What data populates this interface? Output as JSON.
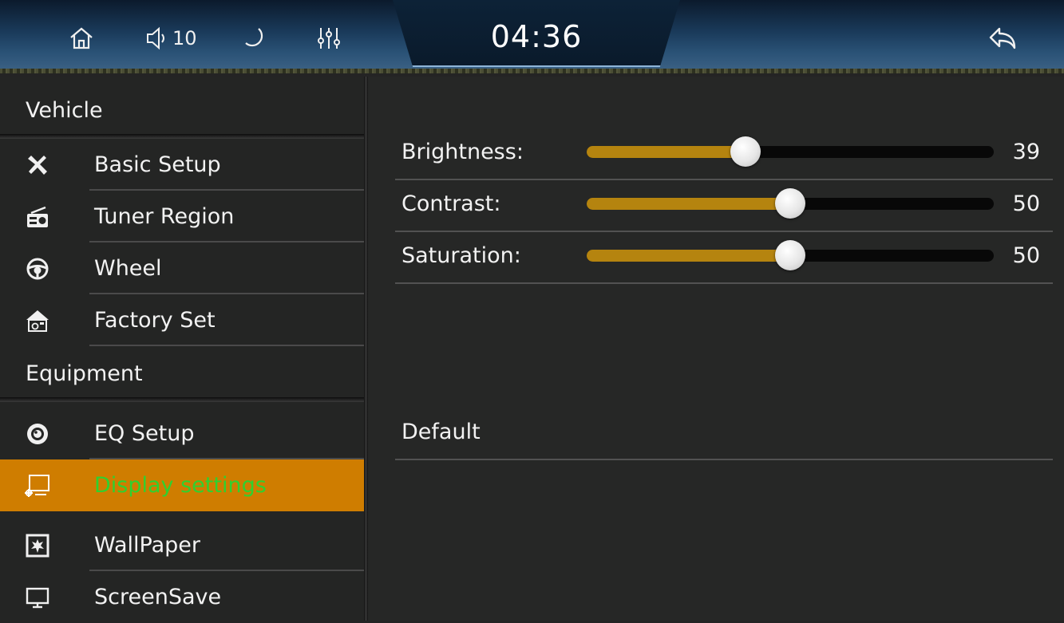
{
  "status_bar": {
    "volume_level": "10",
    "clock": "04:36",
    "icons": [
      "home-icon",
      "volume-icon",
      "night-mode-icon",
      "equalizer-icon",
      "back-icon"
    ]
  },
  "sidebar": {
    "section_vehicle": "Vehicle",
    "section_equipment": "Equipment",
    "items": [
      {
        "label": "Basic Setup",
        "icon": "tools-icon"
      },
      {
        "label": "Tuner Region",
        "icon": "radio-icon"
      },
      {
        "label": "Wheel",
        "icon": "steering-wheel-icon"
      },
      {
        "label": "Factory Set",
        "icon": "factory-house-icon"
      },
      {
        "label": "EQ Setup",
        "icon": "speaker-icon"
      },
      {
        "label": "Display settings",
        "icon": "display-settings-icon",
        "active": true
      },
      {
        "label": "WallPaper",
        "icon": "wallpaper-icon"
      },
      {
        "label": "ScreenSave",
        "icon": "monitor-icon"
      }
    ]
  },
  "display": {
    "sliders": [
      {
        "label": "Brightness:",
        "value": "39",
        "max": 100
      },
      {
        "label": "Contrast:",
        "value": "50",
        "max": 100
      },
      {
        "label": "Saturation:",
        "value": "50",
        "max": 100
      }
    ],
    "default_label": "Default"
  },
  "colors": {
    "active_item_bg": "#cf7d00",
    "active_item_text": "#2fd12f",
    "slider_fill": "#b5840f",
    "slider_track": "#080808"
  }
}
